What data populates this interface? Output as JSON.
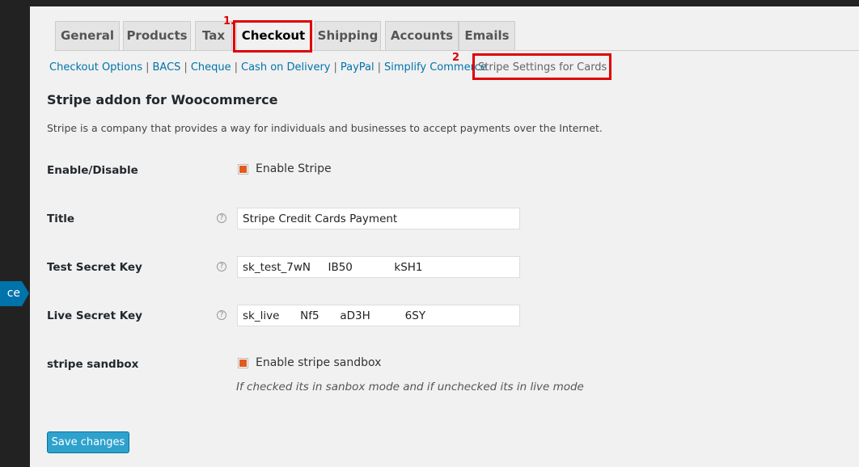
{
  "sidebar": {
    "active_label": "ce"
  },
  "tabs": {
    "general": "General",
    "products": "Products",
    "tax": "Tax",
    "checkout": "Checkout",
    "shipping": "Shipping",
    "accounts": "Accounts",
    "emails": "Emails"
  },
  "annotations": {
    "marker_1": "1.",
    "marker_2": "2"
  },
  "subnav": {
    "checkout_options": "Checkout Options",
    "bacs": "BACS",
    "cheque": "Cheque",
    "cod": "Cash on Delivery",
    "paypal": "PayPal",
    "simplify": "Simplify Commerce",
    "stripe": "Stripe Settings for Cards",
    "separator": "|"
  },
  "section": {
    "title": "Stripe addon for Woocommerce",
    "description": "Stripe is a company that provides a way for individuals and businesses to accept payments over the Internet."
  },
  "fields": {
    "enable_label": "Enable/Disable",
    "enable_checkbox_label": "Enable Stripe",
    "title_label": "Title",
    "title_value": "Stripe Credit Cards Payment",
    "test_key_label": "Test Secret Key",
    "test_key_value": "sk_test_7wN     IB50            kSH1",
    "live_key_label": "Live Secret Key",
    "live_key_value": "sk_live      Nf5      aD3H          6SY",
    "sandbox_label": "stripe sandbox",
    "sandbox_checkbox_label": "Enable stripe sandbox",
    "sandbox_note": "If checked its in sanbox mode and if unchecked its in live mode",
    "help_glyph": "?"
  },
  "actions": {
    "save_label": "Save changes"
  },
  "colors": {
    "accent": "#0073aa",
    "highlight": "#e00000",
    "checkbox": "#e35a1c",
    "button": "#2ea2cc"
  }
}
